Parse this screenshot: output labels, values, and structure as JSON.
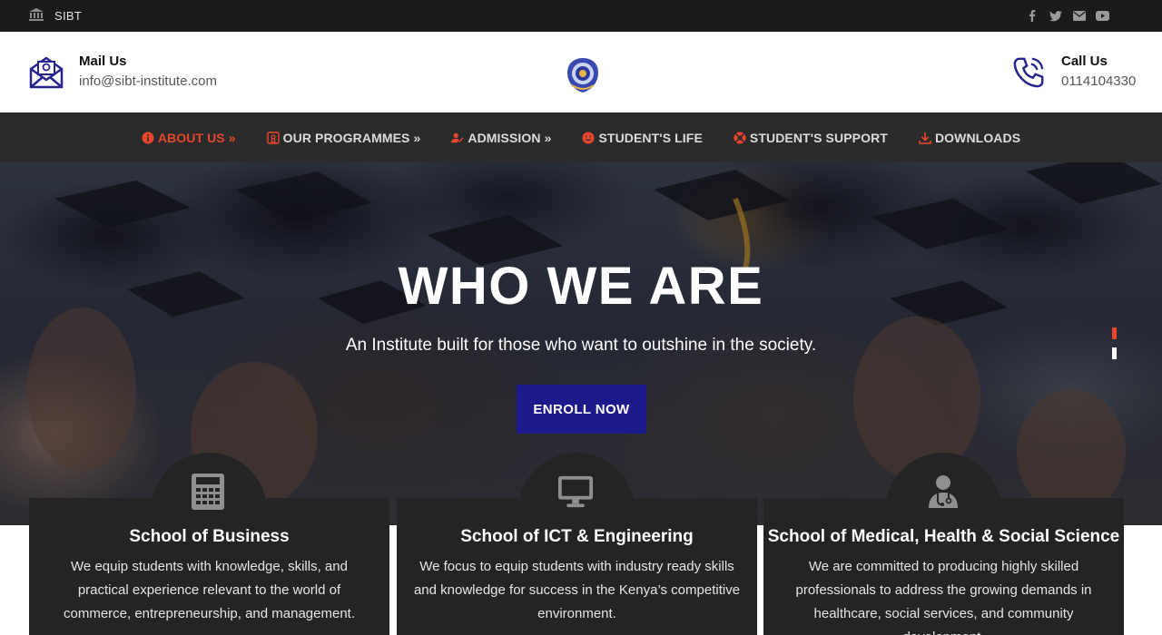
{
  "topbar": {
    "brand_label": "SIBT",
    "social": [
      "facebook-icon",
      "twitter-icon",
      "envelope-icon",
      "youtube-icon"
    ]
  },
  "header": {
    "mail": {
      "title": "Mail Us",
      "value": "info@sibt-institute.com"
    },
    "call": {
      "title": "Call Us",
      "value": "0114104330"
    }
  },
  "nav": {
    "items": [
      {
        "label": "About Us »",
        "icon": "info-circle-icon",
        "active": true
      },
      {
        "label": "Our Programmes »",
        "icon": "certificate-icon",
        "active": false
      },
      {
        "label": "Admission »",
        "icon": "user-edit-icon",
        "active": false
      },
      {
        "label": "Student's Life",
        "icon": "smile-icon",
        "active": false
      },
      {
        "label": "Student's Support",
        "icon": "lifebuoy-icon",
        "active": false
      },
      {
        "label": "Downloads",
        "icon": "download-icon",
        "active": false
      }
    ]
  },
  "hero": {
    "headline": "WHO WE ARE",
    "subtitle": "An Institute built for those who want to outshine in the society.",
    "cta_label": "ENROLL NOW",
    "slides_count": 2,
    "active_slide": 1
  },
  "schools": [
    {
      "title": "School of Business",
      "text": "We equip students with knowledge, skills, and practical experience relevant to the world of commerce, entrepreneurship, and management.",
      "icon": "calculator-icon"
    },
    {
      "title": "School of ICT & Engineering",
      "text": "We focus to equip students with industry ready skills and knowledge for success in the Kenya’s competitive environment.",
      "icon": "desktop-icon"
    },
    {
      "title": "School of Medical, Health & Social Science",
      "text": "We are committed to producing highly skilled professionals to address the growing demands in healthcare, social services, and community development.",
      "icon": "doctor-icon"
    }
  ],
  "colors": {
    "accent": "#e8472c",
    "brand_blue": "#1c1a8a",
    "topbar_bg": "#1b1b1b",
    "nav_bg": "#2b2b2b",
    "card_bg": "#242424"
  }
}
